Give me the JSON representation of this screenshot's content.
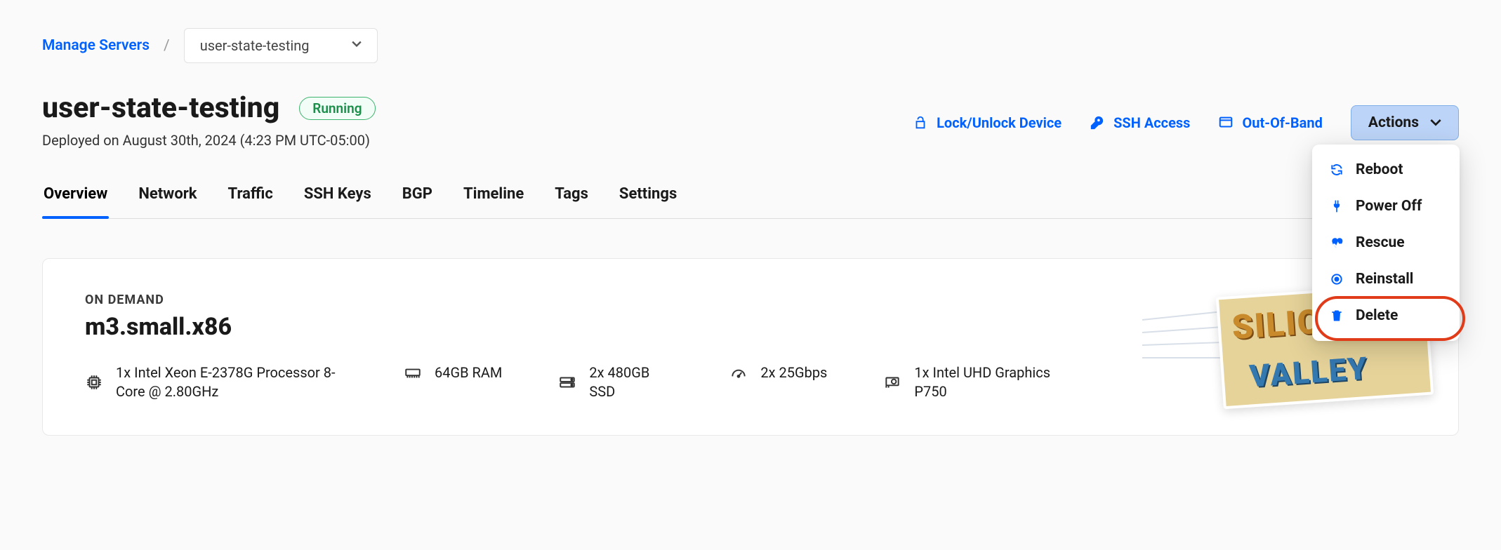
{
  "breadcrumb": {
    "root_label": "Manage Servers",
    "separator": "/",
    "select_value": "user-state-testing"
  },
  "header": {
    "title": "user-state-testing",
    "status": "Running",
    "deployed_text": "Deployed on August 30th, 2024 (4:23 PM UTC-05:00)"
  },
  "toolbar": {
    "lock_label": "Lock/Unlock Device",
    "ssh_label": "SSH Access",
    "oob_label": "Out-Of-Band",
    "actions_label": "Actions"
  },
  "actions_menu": {
    "items": [
      {
        "label": "Reboot",
        "icon": "refresh-icon"
      },
      {
        "label": "Power Off",
        "icon": "plug-icon"
      },
      {
        "label": "Rescue",
        "icon": "heartbeat-icon"
      },
      {
        "label": "Reinstall",
        "icon": "target-icon"
      },
      {
        "label": "Delete",
        "icon": "trash-icon"
      }
    ]
  },
  "tabs": [
    {
      "label": "Overview",
      "active": true
    },
    {
      "label": "Network"
    },
    {
      "label": "Traffic"
    },
    {
      "label": "SSH Keys"
    },
    {
      "label": "BGP"
    },
    {
      "label": "Timeline"
    },
    {
      "label": "Tags"
    },
    {
      "label": "Settings"
    }
  ],
  "overview": {
    "billing_label": "ON DEMAND",
    "plan_name": "m3.small.x86",
    "specs": {
      "cpu": "1x Intel Xeon E-2378G Processor 8-Core @ 2.80GHz",
      "ram": "64GB RAM",
      "disk": "2x 480GB SSD",
      "nic": "2x 25Gbps",
      "gpu": "1x Intel UHD Graphics P750"
    },
    "postcard": {
      "line1": "SILICON",
      "line2": "VALLEY"
    }
  }
}
